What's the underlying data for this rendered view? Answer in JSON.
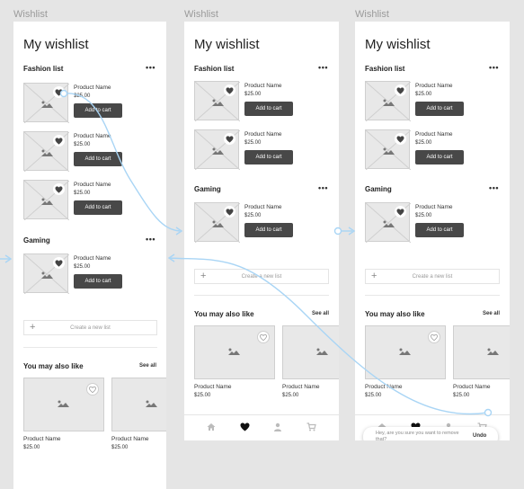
{
  "frames": [
    {
      "label": "Wishlist",
      "title": "My wishlist",
      "fashion_title": "Fashion list",
      "fashion_items": [
        {
          "name": "Product Name",
          "price": "$25.00",
          "button": "Add to cart"
        },
        {
          "name": "Product Name",
          "price": "$25.00",
          "button": "Add to cart"
        },
        {
          "name": "Product Name",
          "price": "$25.00",
          "button": "Add to cart"
        }
      ],
      "gaming_title": "Gaming",
      "gaming_items": [
        {
          "name": "Product Name",
          "price": "$25.00",
          "button": "Add to cart"
        }
      ],
      "create_label": "Create a new list",
      "recs_title": "You may also like",
      "see_all": "See all",
      "recs": [
        {
          "name": "Product Name",
          "price": "$25.00"
        },
        {
          "name": "Product Name",
          "price": "$25.00"
        }
      ]
    },
    {
      "label": "Wishlist",
      "title": "My wishlist",
      "fashion_title": "Fashion list",
      "fashion_items": [
        {
          "name": "Product Name",
          "price": "$25.00",
          "button": "Add to cart"
        },
        {
          "name": "Product Name",
          "price": "$25.00",
          "button": "Add to cart"
        }
      ],
      "gaming_title": "Gaming",
      "gaming_items": [
        {
          "name": "Product Name",
          "price": "$25.00",
          "button": "Add to cart"
        }
      ],
      "create_label": "Create a new list",
      "recs_title": "You may also like",
      "see_all": "See all",
      "recs": [
        {
          "name": "Product Name",
          "price": "$25.00"
        },
        {
          "name": "Product Name",
          "price": "$25.00"
        }
      ]
    },
    {
      "label": "Wishlist",
      "title": "My wishlist",
      "fashion_title": "Fashion list",
      "fashion_items": [
        {
          "name": "Product Name",
          "price": "$25.00",
          "button": "Add to cart"
        },
        {
          "name": "Product Name",
          "price": "$25.00",
          "button": "Add to cart"
        }
      ],
      "gaming_title": "Gaming",
      "gaming_items": [
        {
          "name": "Product Name",
          "price": "$25.00",
          "button": "Add to cart"
        }
      ],
      "create_label": "Create a new list",
      "recs_title": "You may also like",
      "see_all": "See all",
      "recs": [
        {
          "name": "Product Name",
          "price": "$25.00"
        },
        {
          "name": "Product Name",
          "price": "$25.00"
        }
      ],
      "toast": {
        "message": "Hey, are you sure you want to remove that?",
        "action": "Undo"
      }
    }
  ],
  "menu_glyph": "•••",
  "plus_glyph": "+",
  "tabs": [
    "home-icon",
    "heart-icon",
    "user-icon",
    "cart-icon"
  ],
  "colors": {
    "flow_line": "#a9d5f5",
    "button": "#484848",
    "canvas": "#e5e5e5"
  }
}
